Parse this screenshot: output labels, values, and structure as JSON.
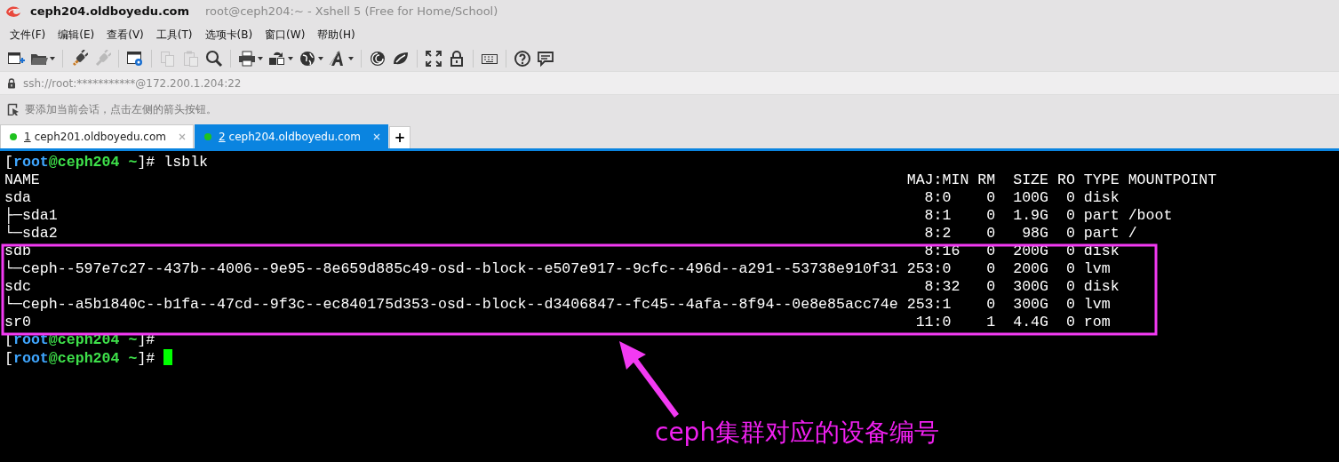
{
  "window": {
    "title": "ceph204.oldboyedu.com",
    "subtitle": "root@ceph204:~ - Xshell 5 (Free for Home/School)"
  },
  "menu": [
    "文件(F)",
    "编辑(E)",
    "查看(V)",
    "工具(T)",
    "选项卡(B)",
    "窗口(W)",
    "帮助(H)"
  ],
  "toolbar": [
    {
      "kind": "new-session",
      "disabled": false,
      "dropdown": false
    },
    {
      "kind": "open",
      "disabled": false,
      "dropdown": true
    },
    {
      "kind": "separator"
    },
    {
      "kind": "connect",
      "disabled": false,
      "dropdown": false
    },
    {
      "kind": "disconnect",
      "disabled": true,
      "dropdown": false
    },
    {
      "kind": "separator"
    },
    {
      "kind": "properties",
      "disabled": false,
      "dropdown": false
    },
    {
      "kind": "separator"
    },
    {
      "kind": "copy",
      "disabled": true,
      "dropdown": false
    },
    {
      "kind": "paste",
      "disabled": true,
      "dropdown": false
    },
    {
      "kind": "search",
      "disabled": false,
      "dropdown": false
    },
    {
      "kind": "separator"
    },
    {
      "kind": "print",
      "disabled": false,
      "dropdown": true
    },
    {
      "kind": "transfer",
      "disabled": false,
      "dropdown": true
    },
    {
      "kind": "globe",
      "disabled": false,
      "dropdown": true
    },
    {
      "kind": "font",
      "disabled": false,
      "dropdown": true
    },
    {
      "kind": "separator"
    },
    {
      "kind": "shell",
      "disabled": false,
      "dropdown": false
    },
    {
      "kind": "leaf",
      "disabled": false,
      "dropdown": false
    },
    {
      "kind": "separator"
    },
    {
      "kind": "fullscreen",
      "disabled": false,
      "dropdown": false
    },
    {
      "kind": "lock",
      "disabled": false,
      "dropdown": false
    },
    {
      "kind": "separator"
    },
    {
      "kind": "keyboard",
      "disabled": false,
      "dropdown": false
    },
    {
      "kind": "separator"
    },
    {
      "kind": "help",
      "disabled": false,
      "dropdown": false
    },
    {
      "kind": "chat",
      "disabled": false,
      "dropdown": false
    }
  ],
  "address": "ssh://root:***********@172.200.1.204:22",
  "hint": "要添加当前会话，点击左侧的箭头按钮。",
  "tabs": [
    {
      "number": "1",
      "label": "ceph201.oldboyedu.com",
      "selected": false,
      "connected": true
    },
    {
      "number": "2",
      "label": "ceph204.oldboyedu.com",
      "selected": true,
      "connected": true
    }
  ],
  "new_tab": "+",
  "terminal": {
    "lines": [
      {
        "kind": "prompt",
        "cursor": false,
        "segments": [
          {
            "text": "[",
            "kind": "plain"
          },
          {
            "text": "root",
            "kind": "user"
          },
          {
            "text": "@ceph204 ~",
            "kind": "host"
          },
          {
            "text": "]# lsblk",
            "kind": "plain"
          }
        ]
      },
      {
        "kind": "table",
        "columns": [
          "NAME",
          "MAJ:MIN",
          "RM",
          "SIZE",
          "RO",
          "TYPE",
          "MOUNTPOINT"
        ],
        "rows": [
          [
            "sda",
            "8:0",
            "0",
            "100G",
            "0",
            "disk",
            ""
          ],
          [
            "├─sda1",
            "8:1",
            "0",
            "1.9G",
            "0",
            "part",
            "/boot"
          ],
          [
            "└─sda2",
            "8:2",
            "0",
            "98G",
            "0",
            "part",
            "/"
          ],
          [
            "sdb",
            "8:16",
            "0",
            "200G",
            "0",
            "disk",
            ""
          ],
          [
            "└─ceph--597e7c27--437b--4006--9e95--8e659d885c49-osd--block--e507e917--9cfc--496d--a291--53738e910f31",
            "253:0",
            "0",
            "200G",
            "0",
            "lvm",
            ""
          ],
          [
            "sdc",
            "8:32",
            "0",
            "300G",
            "0",
            "disk",
            ""
          ],
          [
            "└─ceph--a5b1840c--b1fa--47cd--9f3c--ec840175d353-osd--block--d3406847--fc45--4afa--8f94--0e8e85acc74e",
            "253:1",
            "0",
            "300G",
            "0",
            "lvm",
            ""
          ],
          [
            "sr0",
            "11:0",
            "1",
            "4.4G",
            "0",
            "rom",
            ""
          ]
        ]
      },
      {
        "kind": "prompt",
        "cursor": false,
        "segments": [
          {
            "text": "[",
            "kind": "plain"
          },
          {
            "text": "root",
            "kind": "user"
          },
          {
            "text": "@ceph204 ~",
            "kind": "host"
          },
          {
            "text": "]#",
            "kind": "plain"
          }
        ]
      },
      {
        "kind": "prompt",
        "cursor": true,
        "segments": [
          {
            "text": "[",
            "kind": "plain"
          },
          {
            "text": "root",
            "kind": "user"
          },
          {
            "text": "@ceph204 ~",
            "kind": "host"
          },
          {
            "text": "]# ",
            "kind": "plain"
          }
        ]
      }
    ]
  },
  "annotation": {
    "label": "ceph集群对应的设备编号"
  }
}
